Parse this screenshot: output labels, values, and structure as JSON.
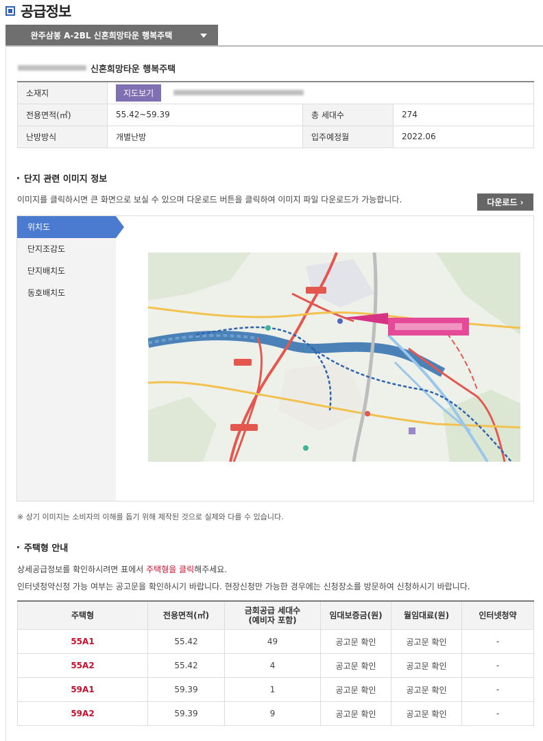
{
  "page": {
    "title": "공급정보"
  },
  "selector": {
    "value": "완주삼봉 A-2BL 신혼희망타운 행복주택"
  },
  "complex": {
    "name_visible": "신혼희망타운 행복주택"
  },
  "info": {
    "location_label": "소재지",
    "map_button": "지도보기",
    "area_label": "전용면적(㎡)",
    "area_value": "55.42~59.39",
    "households_label": "총 세대수",
    "households_value": "274",
    "heating_label": "난방방식",
    "heating_value": "개별난방",
    "movein_label": "입주예정월",
    "movein_value": "2022.06"
  },
  "images_section": {
    "title": "단지 관련 이미지 정보",
    "description": "이미지를 클릭하시면 큰 화면으로 보실 수 있으며 다운로드 버튼을 클릭하여 이미지 파일 다운로드가 가능합니다.",
    "download_button": "다운로드 ›",
    "tabs": [
      {
        "label": "위치도",
        "active": true
      },
      {
        "label": "단지조감도",
        "active": false
      },
      {
        "label": "단지배치도",
        "active": false
      },
      {
        "label": "동호배치도",
        "active": false
      }
    ],
    "notice": "※  상기 이미지는 소비자의 이해를 돕기 위해 제작된 것으로 실제와 다를 수 있습니다."
  },
  "housing_section": {
    "title": "주택형 안내",
    "desc1_pre": "상세공급정보를 확인하시려면 표에서 ",
    "desc1_link": "주택형을 클릭",
    "desc1_post": "해주세요.",
    "desc2": "인터넷청약신청 가능 여부는 공고문을 확인하시기 바랍니다. 현장신청만 가능한 경우에는 신청장소를 방문하여 신청하시기 바랍니다.",
    "headers": [
      "주택형",
      "전용면적(㎡)",
      "금회공급 세대수",
      "(예비자 포함)",
      "임대보증금(원)",
      "월임대료(원)",
      "인터넷청약"
    ],
    "rows": [
      {
        "type": "55A1",
        "area": "55.42",
        "units": "49",
        "deposit": "공고문 확인",
        "rent": "공고문 확인",
        "online": "-"
      },
      {
        "type": "55A2",
        "area": "55.42",
        "units": "4",
        "deposit": "공고문 확인",
        "rent": "공고문 확인",
        "online": "-"
      },
      {
        "type": "59A1",
        "area": "59.39",
        "units": "1",
        "deposit": "공고문 확인",
        "rent": "공고문 확인",
        "online": "-"
      },
      {
        "type": "59A2",
        "area": "59.39",
        "units": "9",
        "deposit": "공고문 확인",
        "rent": "공고문 확인",
        "online": "-"
      }
    ]
  },
  "colors": {
    "accent_blue": "#4a7bd1",
    "map_button": "#7e70b3",
    "type_red": "#c8102e"
  }
}
